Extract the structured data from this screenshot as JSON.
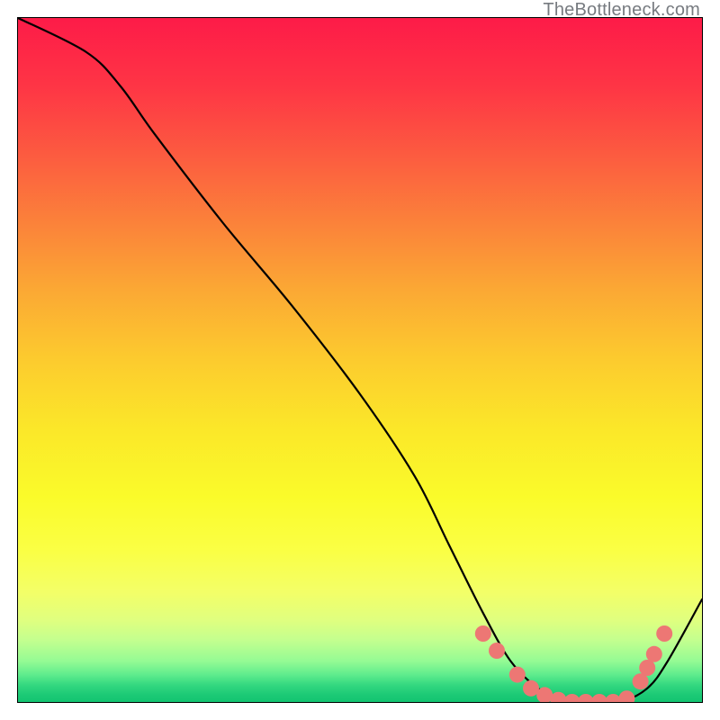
{
  "watermark": "TheBottleneck.com",
  "chart_data": {
    "type": "line",
    "title": "",
    "xlabel": "",
    "ylabel": "",
    "xlim": [
      0,
      100
    ],
    "ylim": [
      0,
      100
    ],
    "x": [
      0,
      10,
      15,
      20,
      30,
      40,
      50,
      58,
      63,
      68,
      72,
      76,
      80,
      84,
      88,
      92,
      95,
      100
    ],
    "values": [
      100,
      95,
      90,
      83,
      70,
      58,
      45,
      33,
      23,
      13,
      6,
      2,
      0,
      0,
      0,
      2,
      6,
      15
    ],
    "series": [
      {
        "name": "curve",
        "type": "line",
        "color": "#000000"
      },
      {
        "name": "markers",
        "type": "scatter",
        "color": "#ed7774",
        "points": [
          {
            "x": 68,
            "y": 10
          },
          {
            "x": 70,
            "y": 7.5
          },
          {
            "x": 73,
            "y": 4
          },
          {
            "x": 75,
            "y": 2
          },
          {
            "x": 77,
            "y": 1
          },
          {
            "x": 79,
            "y": 0.3
          },
          {
            "x": 81,
            "y": 0
          },
          {
            "x": 83,
            "y": 0
          },
          {
            "x": 85,
            "y": 0
          },
          {
            "x": 87,
            "y": 0
          },
          {
            "x": 89,
            "y": 0.5
          },
          {
            "x": 91,
            "y": 3
          },
          {
            "x": 92,
            "y": 5
          },
          {
            "x": 93,
            "y": 7
          },
          {
            "x": 94.5,
            "y": 10
          }
        ]
      }
    ],
    "gradient_stops": [
      {
        "offset": 0.0,
        "color": "#fd1b48"
      },
      {
        "offset": 0.1,
        "color": "#fe3545"
      },
      {
        "offset": 0.2,
        "color": "#fc5b40"
      },
      {
        "offset": 0.3,
        "color": "#fb823a"
      },
      {
        "offset": 0.4,
        "color": "#fba934"
      },
      {
        "offset": 0.5,
        "color": "#fccb2e"
      },
      {
        "offset": 0.6,
        "color": "#fbe729"
      },
      {
        "offset": 0.7,
        "color": "#fafb2a"
      },
      {
        "offset": 0.78,
        "color": "#faff45"
      },
      {
        "offset": 0.84,
        "color": "#f3ff68"
      },
      {
        "offset": 0.88,
        "color": "#e0ff7f"
      },
      {
        "offset": 0.91,
        "color": "#c3ff8f"
      },
      {
        "offset": 0.94,
        "color": "#95fb94"
      },
      {
        "offset": 0.96,
        "color": "#5fec8d"
      },
      {
        "offset": 0.975,
        "color": "#34d880"
      },
      {
        "offset": 0.99,
        "color": "#1bc975"
      },
      {
        "offset": 1.0,
        "color": "#13c471"
      }
    ]
  }
}
